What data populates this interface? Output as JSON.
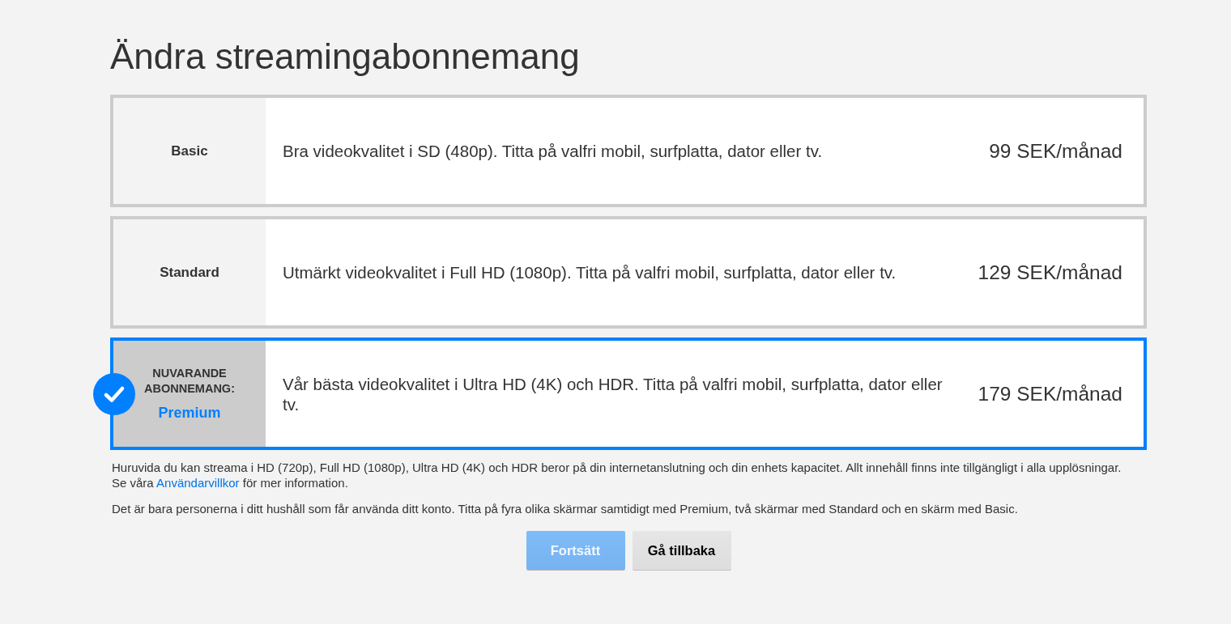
{
  "title": "Ändra streamingabonnemang",
  "plans": [
    {
      "name": "Basic",
      "description": "Bra videokvalitet i SD (480p). Titta på valfri mobil, surfplatta, dator eller tv.",
      "price": "99 SEK/månad",
      "selected": false
    },
    {
      "name": "Standard",
      "description": "Utmärkt videokvalitet i Full HD (1080p). Titta på valfri mobil, surfplatta, dator eller tv.",
      "price": "129 SEK/månad",
      "selected": false
    },
    {
      "current_label": "NUVARANDE ABONNEMANG:",
      "name": "Premium",
      "description": "Vår bästa videokvalitet i Ultra HD (4K) och HDR. Titta på valfri mobil, surfplatta, dator eller tv.",
      "price": "179 SEK/månad",
      "selected": true
    }
  ],
  "notes": [
    {
      "text_before": "Huruvida du kan streama i HD (720p), Full HD (1080p), Ultra HD (4K) och HDR beror på din internetanslutning och din enhets kapacitet. Allt innehåll finns inte tillgängligt i alla upplösningar. Se våra ",
      "link": "Användarvillkor",
      "text_after": " för mer information."
    },
    {
      "text_before": "Det är bara personerna i ditt hushåll som får använda ditt konto. Titta på fyra olika skärmar samtidigt med Premium, två skärmar med Standard och en skärm med Basic."
    }
  ],
  "buttons": [
    {
      "label": "Fortsätt",
      "kind": "primary",
      "disabled": true
    },
    {
      "label": "Gå tillbaka",
      "kind": "secondary",
      "disabled": false
    }
  ]
}
